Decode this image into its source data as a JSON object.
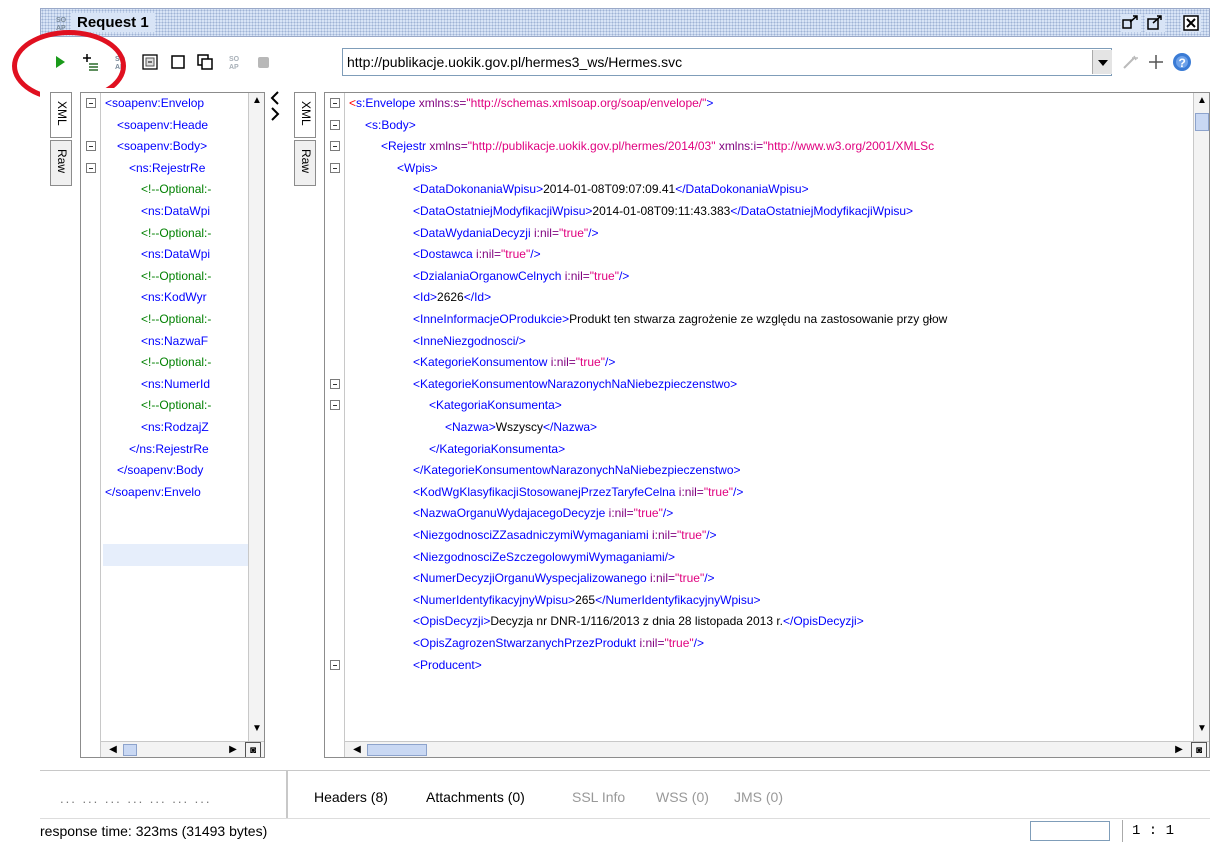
{
  "window": {
    "title": "Request 1",
    "logo_text": "SO\nAP"
  },
  "toolbar": {
    "url": "http://publikacje.uokik.gov.pl/hermes3_ws/Hermes.svc"
  },
  "left_pane": {
    "tabs": [
      "XML",
      "Raw"
    ],
    "lines": [
      {
        "indent": 0,
        "fold": true,
        "parts": [
          [
            "tag",
            "<soapenv:Envelop"
          ]
        ]
      },
      {
        "indent": 1,
        "fold": false,
        "parts": [
          [
            "tag",
            "<soapenv:Heade"
          ]
        ]
      },
      {
        "indent": 1,
        "fold": true,
        "parts": [
          [
            "tag",
            "<soapenv:Body>"
          ]
        ]
      },
      {
        "indent": 2,
        "fold": true,
        "parts": [
          [
            "tag",
            "<ns:RejestrRe"
          ]
        ]
      },
      {
        "indent": 3,
        "fold": false,
        "parts": [
          [
            "com",
            "<!--Optional:-"
          ]
        ]
      },
      {
        "indent": 3,
        "fold": false,
        "parts": [
          [
            "tag",
            "<ns:DataWpi"
          ]
        ]
      },
      {
        "indent": 3,
        "fold": false,
        "parts": [
          [
            "com",
            "<!--Optional:-"
          ]
        ]
      },
      {
        "indent": 3,
        "fold": false,
        "parts": [
          [
            "tag",
            "<ns:DataWpi"
          ]
        ]
      },
      {
        "indent": 3,
        "fold": false,
        "parts": [
          [
            "com",
            "<!--Optional:-"
          ]
        ]
      },
      {
        "indent": 3,
        "fold": false,
        "parts": [
          [
            "tag",
            "<ns:KodWyr"
          ]
        ]
      },
      {
        "indent": 3,
        "fold": false,
        "parts": [
          [
            "com",
            "<!--Optional:-"
          ]
        ]
      },
      {
        "indent": 3,
        "fold": false,
        "parts": [
          [
            "tag",
            "<ns:NazwaF"
          ]
        ]
      },
      {
        "indent": 3,
        "fold": false,
        "parts": [
          [
            "com",
            "<!--Optional:-"
          ]
        ]
      },
      {
        "indent": 3,
        "fold": false,
        "parts": [
          [
            "tag",
            "<ns:NumerId"
          ]
        ]
      },
      {
        "indent": 3,
        "fold": false,
        "parts": [
          [
            "com",
            "<!--Optional:-"
          ]
        ]
      },
      {
        "indent": 3,
        "fold": false,
        "parts": [
          [
            "tag",
            "<ns:RodzajZ"
          ]
        ]
      },
      {
        "indent": 2,
        "fold": false,
        "parts": [
          [
            "tag",
            "</ns:RejestrRe"
          ]
        ]
      },
      {
        "indent": 1,
        "fold": false,
        "parts": [
          [
            "tag",
            "</soapenv:Body"
          ]
        ]
      },
      {
        "indent": 0,
        "fold": false,
        "parts": [
          [
            "tag",
            "</soapenv:Envelo"
          ]
        ]
      }
    ]
  },
  "right_pane": {
    "tabs": [
      "XML",
      "Raw"
    ],
    "lines": [
      {
        "indent": 0,
        "fold": true,
        "parts": [
          [
            "red",
            "<"
          ],
          [
            "tag",
            "s:Envelope "
          ],
          [
            "attr",
            "xmlns:s="
          ],
          [
            "str",
            "\"http://schemas.xmlsoap.org/soap/envelope/\""
          ],
          [
            "tag",
            ">"
          ]
        ]
      },
      {
        "indent": 1,
        "fold": true,
        "parts": [
          [
            "tag",
            "<s:Body>"
          ]
        ]
      },
      {
        "indent": 2,
        "fold": true,
        "parts": [
          [
            "tag",
            "<Rejestr "
          ],
          [
            "attr",
            "xmlns="
          ],
          [
            "str",
            "\"http://publikacje.uokik.gov.pl/hermes/2014/03\" "
          ],
          [
            "attr",
            "xmlns:i="
          ],
          [
            "str",
            "\"http://www.w3.org/2001/XMLSc"
          ]
        ]
      },
      {
        "indent": 3,
        "fold": true,
        "parts": [
          [
            "tag",
            "<Wpis>"
          ]
        ]
      },
      {
        "indent": 4,
        "fold": false,
        "parts": [
          [
            "tag",
            "<DataDokonaniaWpisu>"
          ],
          [
            "txt",
            "2014-01-08T09:07:09.41"
          ],
          [
            "tag",
            "</DataDokonaniaWpisu>"
          ]
        ]
      },
      {
        "indent": 4,
        "fold": false,
        "parts": [
          [
            "tag",
            "<DataOstatniejModyfikacjiWpisu>"
          ],
          [
            "txt",
            "2014-01-08T09:11:43.383"
          ],
          [
            "tag",
            "</DataOstatniejModyfikacjiWpisu>"
          ]
        ]
      },
      {
        "indent": 4,
        "fold": false,
        "parts": [
          [
            "tag",
            "<DataWydaniaDecyzji "
          ],
          [
            "attr",
            "i:nil="
          ],
          [
            "str",
            "\"true\""
          ],
          [
            "tag",
            "/>"
          ]
        ]
      },
      {
        "indent": 4,
        "fold": false,
        "parts": [
          [
            "tag",
            "<Dostawca "
          ],
          [
            "attr",
            "i:nil="
          ],
          [
            "str",
            "\"true\""
          ],
          [
            "tag",
            "/>"
          ]
        ]
      },
      {
        "indent": 4,
        "fold": false,
        "parts": [
          [
            "tag",
            "<DzialaniaOrganowCelnych "
          ],
          [
            "attr",
            "i:nil="
          ],
          [
            "str",
            "\"true\""
          ],
          [
            "tag",
            "/>"
          ]
        ]
      },
      {
        "indent": 4,
        "fold": false,
        "parts": [
          [
            "tag",
            "<Id>"
          ],
          [
            "txt",
            "2626"
          ],
          [
            "tag",
            "</Id>"
          ]
        ]
      },
      {
        "indent": 4,
        "fold": false,
        "parts": [
          [
            "tag",
            "<InneInformacjeOProdukcie>"
          ],
          [
            "txt",
            "Produkt ten stwarza zagrożenie ze względu na zastosowanie przy głow"
          ]
        ]
      },
      {
        "indent": 4,
        "fold": false,
        "parts": [
          [
            "tag",
            "<InneNiezgodnosci/>"
          ]
        ]
      },
      {
        "indent": 4,
        "fold": false,
        "parts": [
          [
            "tag",
            "<KategorieKonsumentow "
          ],
          [
            "attr",
            "i:nil="
          ],
          [
            "str",
            "\"true\""
          ],
          [
            "tag",
            "/>"
          ]
        ]
      },
      {
        "indent": 4,
        "fold": true,
        "parts": [
          [
            "tag",
            "<KategorieKonsumentowNarazonychNaNiebezpieczenstwo>"
          ]
        ]
      },
      {
        "indent": 5,
        "fold": true,
        "parts": [
          [
            "tag",
            "<KategoriaKonsumenta>"
          ]
        ]
      },
      {
        "indent": 6,
        "fold": false,
        "parts": [
          [
            "tag",
            "<Nazwa>"
          ],
          [
            "txt",
            "Wszyscy"
          ],
          [
            "tag",
            "</Nazwa>"
          ]
        ]
      },
      {
        "indent": 5,
        "fold": false,
        "parts": [
          [
            "tag",
            "</KategoriaKonsumenta>"
          ]
        ]
      },
      {
        "indent": 4,
        "fold": false,
        "parts": [
          [
            "tag",
            "</KategorieKonsumentowNarazonychNaNiebezpieczenstwo>"
          ]
        ]
      },
      {
        "indent": 4,
        "fold": false,
        "parts": [
          [
            "tag",
            "<KodWgKlasyfikacjiStosowanejPrzezTaryfeCelna "
          ],
          [
            "attr",
            "i:nil="
          ],
          [
            "str",
            "\"true\""
          ],
          [
            "tag",
            "/>"
          ]
        ]
      },
      {
        "indent": 4,
        "fold": false,
        "parts": [
          [
            "tag",
            "<NazwaOrganuWydajacegoDecyzje "
          ],
          [
            "attr",
            "i:nil="
          ],
          [
            "str",
            "\"true\""
          ],
          [
            "tag",
            "/>"
          ]
        ]
      },
      {
        "indent": 4,
        "fold": false,
        "parts": [
          [
            "tag",
            "<NiezgodnosciZZasadniczymiWymaganiami "
          ],
          [
            "attr",
            "i:nil="
          ],
          [
            "str",
            "\"true\""
          ],
          [
            "tag",
            "/>"
          ]
        ]
      },
      {
        "indent": 4,
        "fold": false,
        "parts": [
          [
            "tag",
            "<NiezgodnosciZeSzczegolowymiWymaganiami/>"
          ]
        ]
      },
      {
        "indent": 4,
        "fold": false,
        "parts": [
          [
            "tag",
            "<NumerDecyzjiOrganuWyspecjalizowanego "
          ],
          [
            "attr",
            "i:nil="
          ],
          [
            "str",
            "\"true\""
          ],
          [
            "tag",
            "/>"
          ]
        ]
      },
      {
        "indent": 4,
        "fold": false,
        "parts": [
          [
            "tag",
            "<NumerIdentyfikacyjnyWpisu>"
          ],
          [
            "txt",
            "265"
          ],
          [
            "tag",
            "</NumerIdentyfikacyjnyWpisu>"
          ]
        ]
      },
      {
        "indent": 4,
        "fold": false,
        "parts": [
          [
            "tag",
            "<OpisDecyzji>"
          ],
          [
            "txt",
            "Decyzja nr DNR-1/116/2013 z dnia 28 listopada 2013 r."
          ],
          [
            "tag",
            "</OpisDecyzji>"
          ]
        ]
      },
      {
        "indent": 4,
        "fold": false,
        "parts": [
          [
            "tag",
            "<OpisZagrozenStwarzanychPrzezProdukt "
          ],
          [
            "attr",
            "i:nil="
          ],
          [
            "str",
            "\"true\""
          ],
          [
            "tag",
            "/>"
          ]
        ]
      },
      {
        "indent": 4,
        "fold": true,
        "parts": [
          [
            "tag",
            "<Producent>"
          ]
        ]
      }
    ]
  },
  "left_bottom": {
    "text": "... ... ... ... ... ... ..."
  },
  "bottom_tabs": {
    "headers": "Headers (8)",
    "attachments": "Attachments (0)",
    "ssl": "SSL Info",
    "wss": "WSS (0)",
    "jms": "JMS (0)"
  },
  "status": {
    "response": "response time: 323ms (31493 bytes)",
    "position": "1 : 1"
  },
  "colors": {
    "tag": "#0000ff",
    "attr": "#7f007f",
    "string": "#e0007f",
    "comment": "#008000",
    "highlight": "#e01020"
  }
}
